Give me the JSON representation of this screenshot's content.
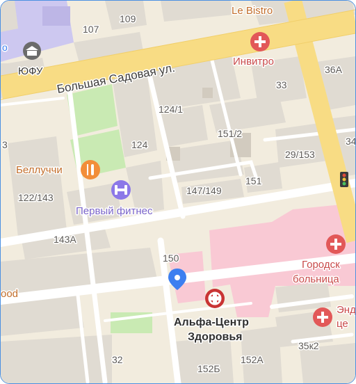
{
  "map": {
    "street_label": "Большая Садовая ул.",
    "places": {
      "le_bistro": "Le Bistro",
      "invitro": "Инвитро",
      "yufu": "ЮФУ",
      "belluchchi": "Беллуччи",
      "perviy_fitnes": "Первый фитнес",
      "gorodskaya_1": "Городск",
      "gorodskaya_2": "больница",
      "alfa_1": "Альфа-Центр",
      "alfa_2": "Здоровья",
      "end_1": "Энд",
      "end_2": "це",
      "food": "ood"
    },
    "house_numbers": {
      "n109": "109",
      "n107": "107",
      "n36a": "36А",
      "n33": "33",
      "n124_1": "124/1",
      "n151_2": "151/2",
      "n124": "124",
      "n29_153": "29/153",
      "n3": "3",
      "n34": "34",
      "n122_143": "122/143",
      "n147_149": "147/149",
      "n151": "151",
      "n143a": "143А",
      "n150": "150",
      "n35k2": "35к2",
      "n32": "32",
      "n152b": "152Б",
      "n152a": "152А",
      "n_o": "о"
    },
    "colors": {
      "background": "#f2ecde",
      "major_road": "#f8dc84",
      "road": "#ffffff",
      "building": "#e0dbd2",
      "building_shadow": "#d2cbbf",
      "campus": "#cdc8f0",
      "park": "#c9eab3",
      "hospital": "#f9c9d4",
      "poi_red": "#e25858",
      "poi_orange": "#f28e39",
      "poi_purple": "#8c78e8",
      "location_pin": "#3d7ff0"
    },
    "icons": {
      "university": "university-icon",
      "medical": "medical-cross-icon",
      "restaurant": "restaurant-icon",
      "fitness": "fitness-icon",
      "alfa": "alfa-center-icon",
      "location": "location-pin-icon",
      "traffic_light": "traffic-light-icon"
    }
  }
}
